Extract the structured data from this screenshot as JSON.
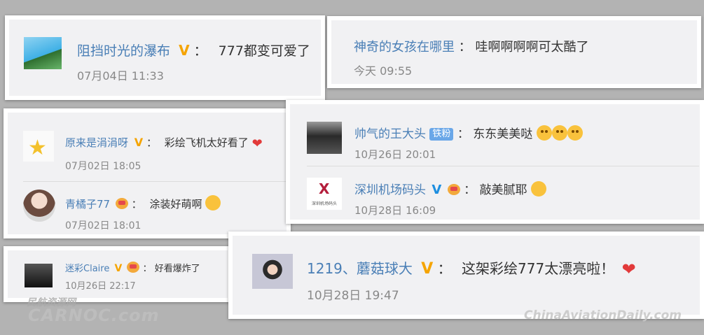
{
  "comments": [
    {
      "id": "c1",
      "user": "阻挡时光的瀑布",
      "badge": "V",
      "sep": "：",
      "text": "777都变可爱了",
      "time": "07月04日 11:33"
    },
    {
      "id": "c2",
      "user": "神奇的女孩在哪里",
      "sep": "：",
      "text": "哇啊啊啊啊可太酷了",
      "time": "今天 09:55"
    },
    {
      "id": "c3",
      "user": "原来是涓涓呀",
      "badge": "V",
      "sep": "：",
      "text": "彩绘飞机太好看了",
      "time": "07月02日 18:05"
    },
    {
      "id": "c4",
      "user": "青橘子77",
      "sep": "：",
      "text": "涂装好萌啊",
      "time": "07月02日 18:01"
    },
    {
      "id": "c5",
      "user": "帅气的王大头",
      "fan_badge": "铁粉",
      "sep": "：",
      "text": "东东美美哒",
      "time": "10月26日 20:01"
    },
    {
      "id": "c6",
      "user": "深圳机场码头",
      "badge": "V",
      "sep": "：",
      "text": "敲美腻耶",
      "time": "10月28日 16:09",
      "avatar_text": "深圳机场码头"
    },
    {
      "id": "c7",
      "user": "迷彩Claire",
      "badge": "V",
      "sep": "：",
      "text": "好看爆炸了",
      "time": "10月26日 22:17"
    },
    {
      "id": "c8",
      "user": "1219、蘑菇球大",
      "badge": "V",
      "sep": "：",
      "text": "这架彩绘777太漂亮啦！",
      "time": "10月28日 19:47"
    }
  ],
  "watermarks": {
    "left_top": "民航资源网",
    "left_bottom": "CARNOC.com",
    "right": "ChinaAviationDaily.com"
  },
  "colors": {
    "name": "#4a7fb6",
    "vip_badge": "#f5a400",
    "verified_badge": "#1e8fe0",
    "card": "#f1f1f3",
    "background": "#b3b3b3"
  }
}
